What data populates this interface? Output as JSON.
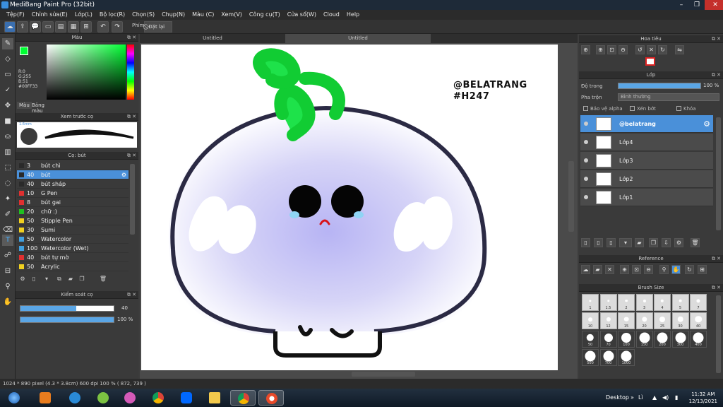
{
  "window": {
    "title": "MediBang Paint Pro (32bit)"
  },
  "menu": [
    "Tệp(F)",
    "Chỉnh sửa(E)",
    "Lớp(L)",
    "Bộ lọc(R)",
    "Chọn(S)",
    "Chụp(N)",
    "Màu (C)",
    "Xem(V)",
    "Công cụ(T)",
    "Cửa sổ(W)",
    "Cloud",
    "Help"
  ],
  "toolbar": {
    "keys_label": "Phím",
    "reset_label": "Đặt lại"
  },
  "color_panel": {
    "title": "Màu",
    "rgb_text": "R:0\nG:255\nB:51\n#00FF33",
    "tabs": [
      "Màu",
      "Bảng màu"
    ],
    "fg_color": "#00ff33"
  },
  "brush_preview": {
    "title": "Xem trước cọ",
    "size_label": "1.6mm"
  },
  "brush_panel": {
    "title": "Cọ: bút",
    "items": [
      {
        "size": "3",
        "name": "bút chì",
        "color": "#2a2a2a"
      },
      {
        "size": "40",
        "name": "bút",
        "color": "#2a2a2a",
        "selected": true
      },
      {
        "size": "40",
        "name": "bút sháp",
        "color": "#2a2a2a"
      },
      {
        "size": "10",
        "name": "G Pen",
        "color": "#e03030"
      },
      {
        "size": "8",
        "name": "bút gai",
        "color": "#e03030"
      },
      {
        "size": "20",
        "name": "chữ :)",
        "color": "#20c020"
      },
      {
        "size": "50",
        "name": "Stipple Pen",
        "color": "#f0d020"
      },
      {
        "size": "30",
        "name": "Sumi",
        "color": "#f0d020"
      },
      {
        "size": "50",
        "name": "Watercolor",
        "color": "#40a0e0"
      },
      {
        "size": "100",
        "name": "Watercolor (Wet)",
        "color": "#40a0e0"
      },
      {
        "size": "40",
        "name": "bút tự mờ",
        "color": "#e03030"
      },
      {
        "size": "50",
        "name": "Acrylic",
        "color": "#f0d020"
      }
    ]
  },
  "brush_control": {
    "title": "Kiểm soát cọ",
    "size_value": "40",
    "size_fraction": 0.6,
    "opacity_value": "100 %",
    "opacity_fraction": 1.0
  },
  "doc_tabs": [
    "Untitled",
    "Untitled"
  ],
  "canvas": {
    "watermark_line1": "@BELATRANG",
    "watermark_line2": "#H247"
  },
  "navigator": {
    "title": "Hoa tiêu"
  },
  "layer_panel": {
    "title": "Lớp",
    "opacity_label": "Độ trong",
    "opacity_value": "100 %",
    "blend_label": "Pha trộn",
    "blend_value": "Bình thường",
    "protect_alpha": "Bảo vệ alpha",
    "clipping": "Xén bớt",
    "lock": "Khóa",
    "layers": [
      {
        "name": "@belatrang",
        "selected": true
      },
      {
        "name": "Lớp4"
      },
      {
        "name": "Lớp3"
      },
      {
        "name": "Lớp2"
      },
      {
        "name": "Lớp1"
      }
    ]
  },
  "reference": {
    "title": "Reference"
  },
  "brush_size": {
    "title": "Brush Size",
    "sizes": [
      "1",
      "1.5",
      "2",
      "3",
      "4",
      "5",
      "7",
      "10",
      "12",
      "15",
      "20",
      "25",
      "30",
      "40",
      "50",
      "70",
      "100",
      "150",
      "200",
      "300",
      "400",
      "500",
      "700",
      "1000"
    ]
  },
  "status": {
    "text": "1024 * 890 pixel  (4.3 * 3.8cm)  600 dpi  100 %  ( 872, 739 )"
  },
  "taskbar": {
    "desktop_label": "Desktop",
    "lang": "Lì",
    "time": "11:32 AM",
    "date": "12/13/2021"
  }
}
